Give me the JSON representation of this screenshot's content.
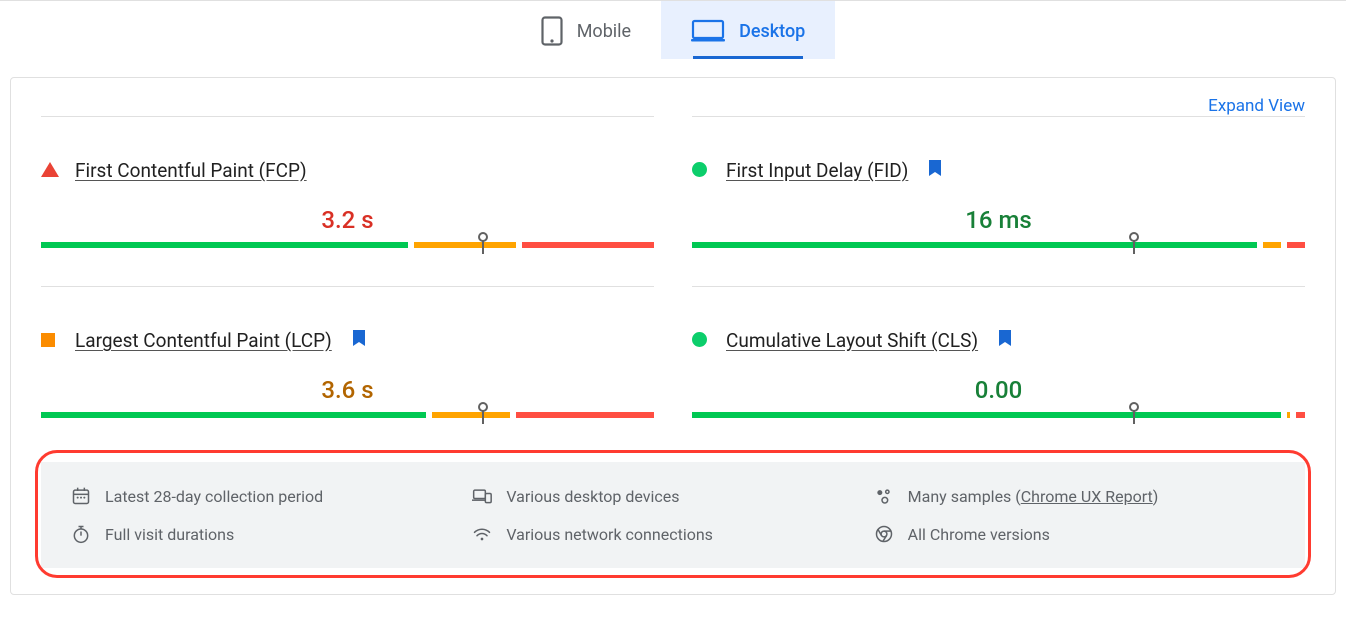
{
  "tabs": {
    "mobile": "Mobile",
    "desktop": "Desktop"
  },
  "expand_label": "Expand View",
  "metrics": {
    "fcp": {
      "title": "First Contentful Paint (FCP)",
      "value": "3.2 s"
    },
    "fid": {
      "title": "First Input Delay (FID)",
      "value": "16 ms"
    },
    "lcp": {
      "title": "Largest Contentful Paint (LCP)",
      "value": "3.6 s"
    },
    "cls": {
      "title": "Cumulative Layout Shift (CLS)",
      "value": "0.00"
    }
  },
  "footnotes": {
    "period": "Latest 28-day collection period",
    "devices": "Various desktop devices",
    "samples_prefix": "Many samples (",
    "samples_link": "Chrome UX Report",
    "samples_suffix": ")",
    "durations": "Full visit durations",
    "network": "Various network connections",
    "versions": "All Chrome versions"
  },
  "chart_data": [
    {
      "type": "bar",
      "metric": "First Contentful Paint (FCP)",
      "status": "poor",
      "value_label": "3.2 s",
      "marker_percent": 72,
      "distribution_percent": {
        "good": 61,
        "needs_improvement": 17,
        "poor": 22
      }
    },
    {
      "type": "bar",
      "metric": "First Input Delay (FID)",
      "status": "good",
      "value_label": "16 ms",
      "marker_percent": 72,
      "distribution_percent": {
        "good": 94,
        "needs_improvement": 3,
        "poor": 3
      }
    },
    {
      "type": "bar",
      "metric": "Largest Contentful Paint (LCP)",
      "status": "needs_improvement",
      "value_label": "3.6 s",
      "marker_percent": 72,
      "distribution_percent": {
        "good": 64,
        "needs_improvement": 13,
        "poor": 23
      }
    },
    {
      "type": "bar",
      "metric": "Cumulative Layout Shift (CLS)",
      "status": "good",
      "value_label": "0.00",
      "marker_percent": 72,
      "distribution_percent": {
        "good": 98,
        "needs_improvement": 0.5,
        "poor": 1.5
      }
    }
  ]
}
